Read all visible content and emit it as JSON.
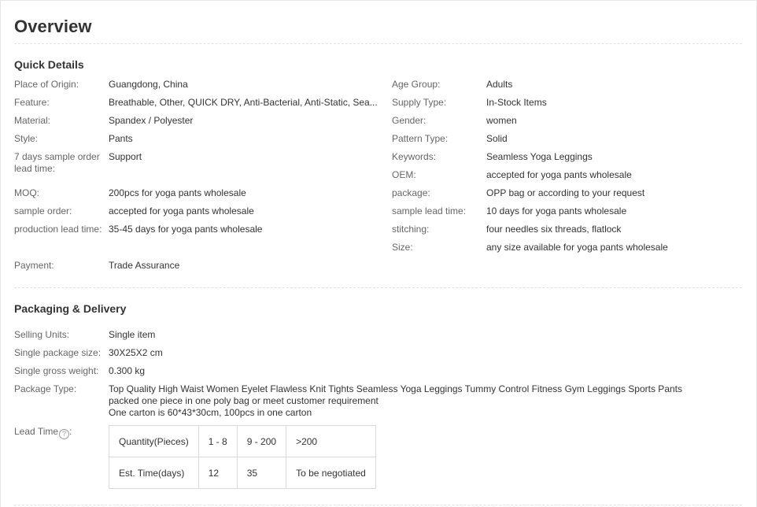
{
  "page_title": "Overview",
  "quick_details": {
    "title": "Quick Details",
    "left": [
      {
        "key": "Place of Origin:",
        "value": "Guangdong, China"
      },
      {
        "key": "Feature:",
        "value": "Breathable, Other, QUICK DRY, Anti-Bacterial, Anti-Static, Sea..."
      },
      {
        "key": "Material:",
        "value": "Spandex / Polyester"
      },
      {
        "key": "Style:",
        "value": "Pants"
      },
      {
        "key": "7 days sample order lead time:",
        "value": "Support"
      },
      {
        "key": "MOQ:",
        "value": "200pcs for yoga pants wholesale"
      },
      {
        "key": "sample order:",
        "value": "accepted for yoga pants wholesale"
      },
      {
        "key": "production lead time:",
        "value": "35-45 days for yoga pants wholesale"
      },
      {
        "key": "Payment:",
        "value": "Trade Assurance"
      }
    ],
    "right": [
      {
        "key": "Age Group:",
        "value": "Adults"
      },
      {
        "key": "Supply Type:",
        "value": "In-Stock Items"
      },
      {
        "key": "Gender:",
        "value": "women"
      },
      {
        "key": "Pattern Type:",
        "value": "Solid"
      },
      {
        "key": "Keywords:",
        "value": "Seamless Yoga Leggings"
      },
      {
        "key": "OEM:",
        "value": "accepted for yoga pants wholesale"
      },
      {
        "key": "package:",
        "value": "OPP bag or according to your request"
      },
      {
        "key": "sample lead time:",
        "value": "10 days for yoga pants wholesale"
      },
      {
        "key": "stitching:",
        "value": "four needles six threads, flatlock"
      },
      {
        "key": "Size:",
        "value": "any size available for yoga pants wholesale"
      }
    ]
  },
  "packaging": {
    "title": "Packaging & Delivery",
    "selling_units": {
      "key": "Selling Units:",
      "value": "Single item"
    },
    "package_size": {
      "key": "Single package size:",
      "value": "30X25X2 cm"
    },
    "gross_weight": {
      "key": "Single gross weight:",
      "value": "0.300 kg"
    },
    "package_type": {
      "key": "Package Type:",
      "lines": [
        "Top Quality High Waist Women Eyelet Flawless Knit Tights Seamless Yoga Leggings Tummy Control Fitness Gym Leggings Sports Pants",
        "packed one piece in one poly bag or meet customer requirement",
        "One carton is 60*43*30cm, 100pcs in one carton"
      ]
    },
    "lead_time": {
      "key": "Lead Time",
      "help_glyph": "?",
      "colon": ":",
      "rows": [
        [
          "Quantity(Pieces)",
          "1 - 8",
          "9 - 200",
          ">200"
        ],
        [
          "Est. Time(days)",
          "12",
          "35",
          "To be negotiated"
        ]
      ]
    }
  }
}
